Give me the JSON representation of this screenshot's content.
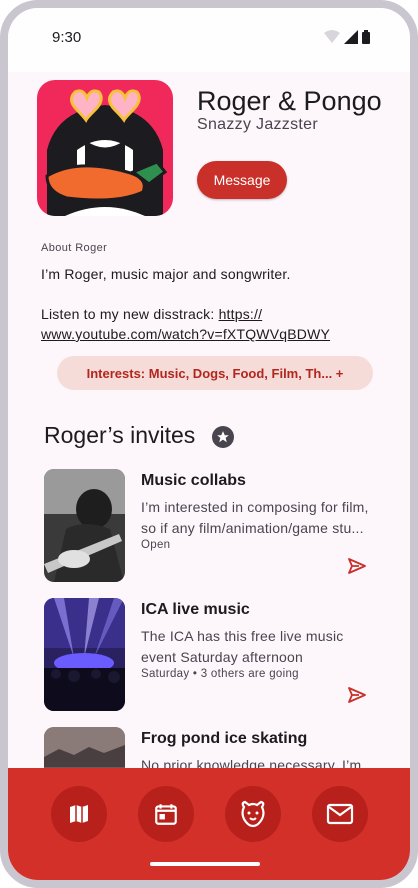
{
  "status": {
    "time": "9:30"
  },
  "profile": {
    "name": "Roger & Pongo",
    "subtitle": "Snazzy Jazzster",
    "message_label": "Message",
    "about_label": "About Roger",
    "bio_line1": "I’m Roger, music major and songwriter.",
    "bio_line2_prefix": "Listen to my new disstrack: ",
    "bio_link": "https://\nwww.youtube.com/watch?v=fXTQWVqBDWY",
    "interests_label": "Interests: Music, Dogs, Food, Film, Th... +"
  },
  "invites_section": {
    "title": "Roger’s invites"
  },
  "invites": [
    {
      "title": "Music collabs",
      "desc": "I’m interested in composing for film, so if any film/animation/game stu...",
      "meta": "Open"
    },
    {
      "title": "ICA live music",
      "desc": "The ICA has this free live music event Saturday afternoon",
      "meta": "Saturday • 3 others are going"
    },
    {
      "title": "Frog pond ice skating",
      "desc": "No prior knowledge necessary, I’m",
      "meta": ""
    }
  ],
  "bottom_nav": {
    "items": [
      "map-icon",
      "calendar-icon",
      "dog-icon",
      "mail-icon"
    ]
  },
  "colors": {
    "accent": "#d3302a",
    "accent_dark": "#b8201c",
    "chip_bg": "#f5dcd8",
    "surface": "#fdf6fb"
  }
}
